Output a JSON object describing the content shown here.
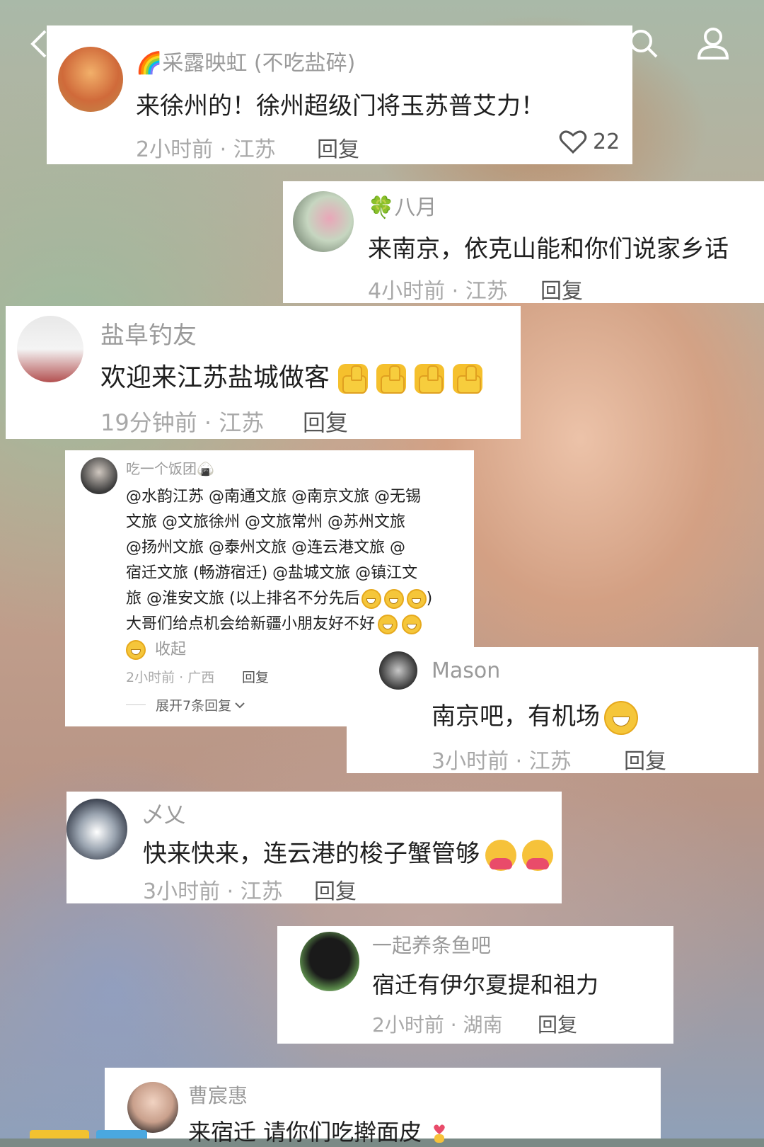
{
  "comments": [
    {
      "name": "🌈采露映虹 (不吃盐碎)",
      "text": "来徐州的！徐州超级门将玉苏普艾力！",
      "meta": "2小时前 · 江苏",
      "reply": "回复",
      "likes": "22"
    },
    {
      "name": "🍀八月",
      "text": "来南京，依克山能和你们说家乡话",
      "meta": "4小时前 · 江苏",
      "reply": "回复"
    },
    {
      "name": "盐阜钓友",
      "text": "欢迎来江苏盐城做客",
      "meta": "19分钟前 · 江苏",
      "reply": "回复"
    },
    {
      "name": "吃一个饭团🍙",
      "lines": [
        "@水韵江苏 @南通文旅 @南京文旅 @无锡",
        "文旅 @文旅徐州 @文旅常州 @苏州文旅",
        "@扬州文旅 @泰州文旅 @连云港文旅 @",
        "宿迁文旅 (畅游宿迁) @盐城文旅 @镇江文",
        "旅 @淮安文旅 (以上排名不分先后",
        "大哥们给点机会给新疆小朋友好不好"
      ],
      "collapse": "收起",
      "meta": "2小时前 · 广西",
      "reply": "回复",
      "expand": "展开7条回复"
    },
    {
      "name": "Mason",
      "text": "南京吧，有机场",
      "meta": "3小时前 · 江苏",
      "reply": "回复"
    },
    {
      "name": "乄乂",
      "text": "快来快来，连云港的梭子蟹管够",
      "meta": "3小时前 · 江苏",
      "reply": "回复"
    },
    {
      "name": "一起养条鱼吧",
      "text": "宿迁有伊尔夏提和祖力",
      "meta": "2小时前 · 湖南",
      "reply": "回复"
    },
    {
      "name": "曹宸惠",
      "text": "来宿迁 请你们吃擀面皮"
    }
  ],
  "icons": {
    "back": "back-arrow-icon",
    "search": "search-icon",
    "profile": "person-icon",
    "heart": "heart-icon"
  }
}
